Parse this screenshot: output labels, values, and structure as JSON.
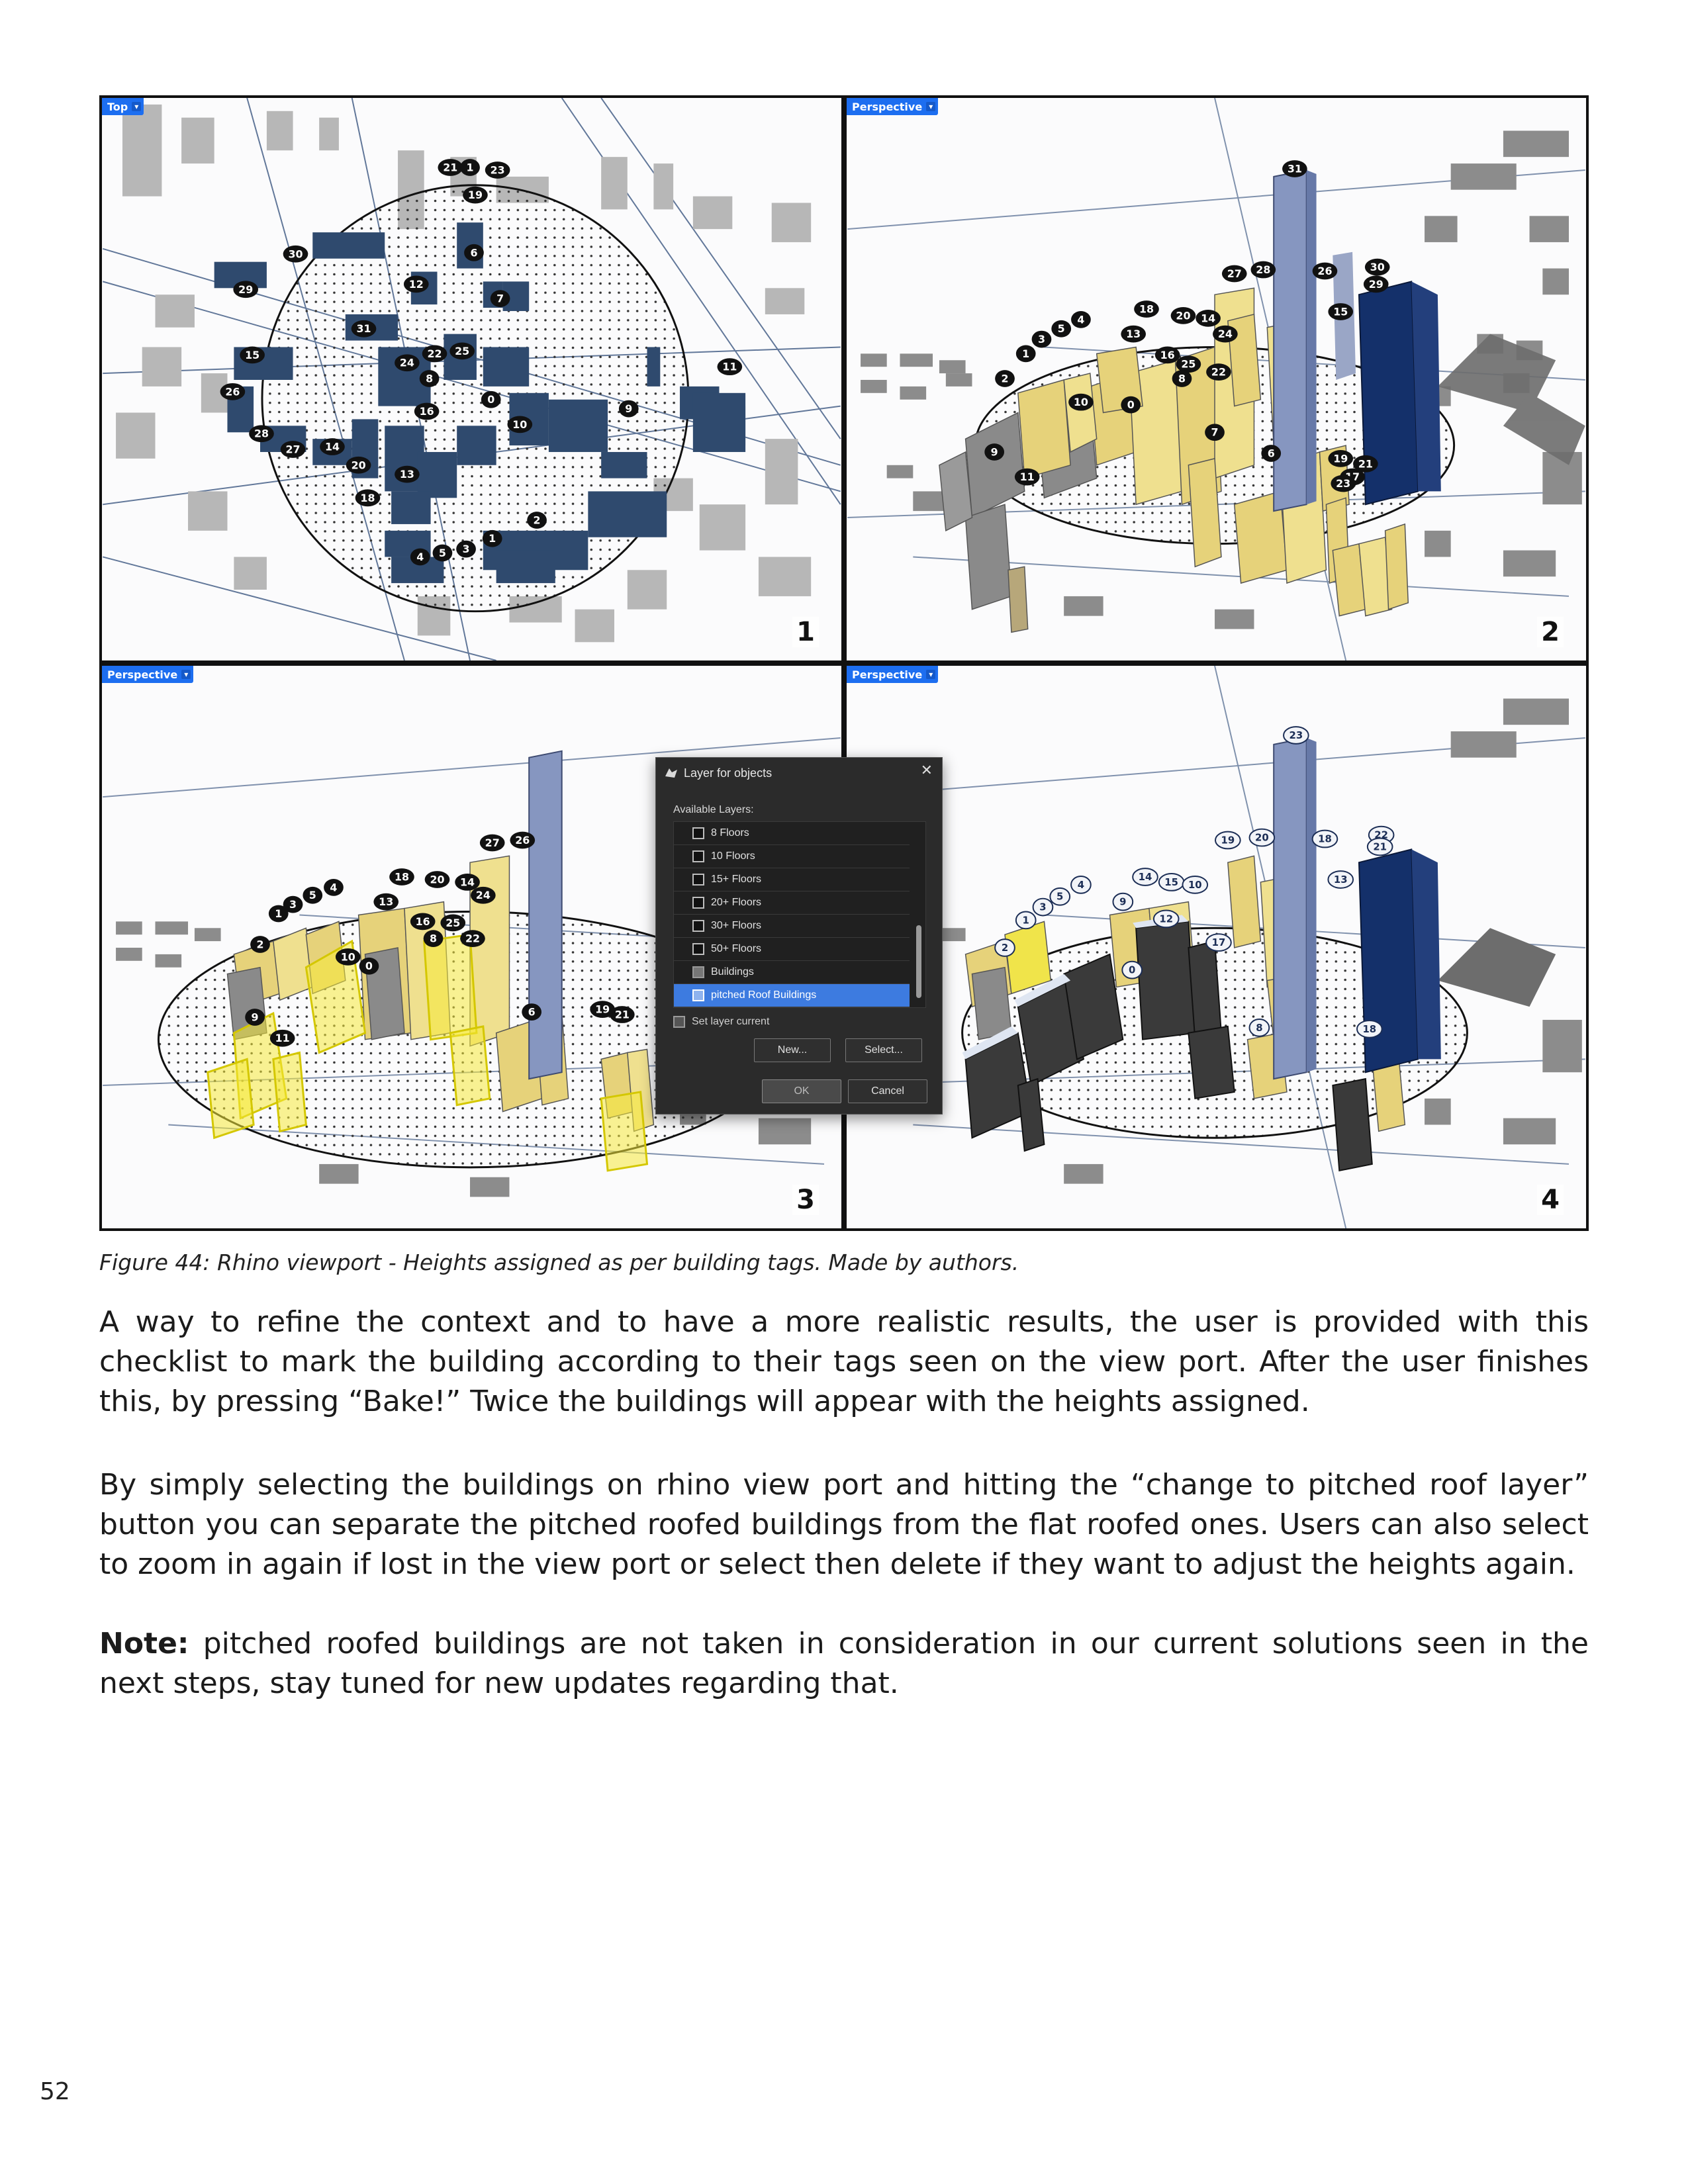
{
  "figure": {
    "viewports": [
      {
        "label": "Top",
        "number": "1"
      },
      {
        "label": "Perspective",
        "number": "2"
      },
      {
        "label": "Perspective",
        "number": "3"
      },
      {
        "label": "Perspective",
        "number": "4"
      }
    ],
    "vp1_tags": [
      "21",
      "1",
      "23",
      "19",
      "6",
      "30",
      "29",
      "12",
      "7",
      "31",
      "15",
      "24",
      "22",
      "25",
      "8",
      "26",
      "0",
      "16",
      "10",
      "11",
      "9",
      "28",
      "27",
      "14",
      "20",
      "13",
      "18",
      "2",
      "1",
      "3",
      "5",
      "4"
    ],
    "vp2_tags": [
      "31",
      "27",
      "28",
      "26",
      "30",
      "29",
      "15",
      "18",
      "20",
      "14",
      "13",
      "24",
      "4",
      "5",
      "3",
      "1",
      "16",
      "25",
      "2",
      "8",
      "22",
      "10",
      "0",
      "7",
      "6",
      "9",
      "11",
      "19",
      "21",
      "17",
      "23"
    ],
    "vp3_tags": [
      "27",
      "26",
      "18",
      "20",
      "14",
      "5",
      "4",
      "3",
      "1",
      "13",
      "16",
      "24",
      "25",
      "2",
      "8",
      "22",
      "10",
      "0",
      "9",
      "11",
      "6",
      "19",
      "21"
    ],
    "vp4_tags": [
      "23",
      "19",
      "20",
      "18",
      "22",
      "21",
      "13",
      "4",
      "5",
      "3",
      "1",
      "14",
      "15",
      "10",
      "9",
      "12",
      "17",
      "2",
      "0",
      "8",
      "18"
    ],
    "dialog": {
      "title": "Layer for objects",
      "available_label": "Available Layers:",
      "layers": [
        "8 Floors",
        "10 Floors",
        "15+ Floors",
        "20+ Floors",
        "30+ Floors",
        "50+ Floors",
        "Buildings",
        "pitched Roof Buildings"
      ],
      "selected_layer": "pitched Roof Buildings",
      "set_layer_current": "Set layer current",
      "new_button": "New...",
      "select_button": "Select...",
      "ok_button": "OK",
      "cancel_button": "Cancel"
    }
  },
  "caption": "Figure 44: Rhino viewport - Heights assigned as per building tags. Made by authors.",
  "paragraph1": "A way to refine the context and to have a more realistic results, the user is provided with this checklist to mark the building according to their tags seen on the view port. After the user finishes this, by pressing “Bake!” Twice the buildings will appear with the heights assigned.",
  "paragraph2": "By simply selecting the buildings on rhino view port and hitting the “change to pitched roof layer” button you can separate the pitched roofed buildings from the flat roofed ones. Users can also select to zoom in again if lost in the view port or select then delete if they want to adjust the heights again.",
  "note_label": "Note:",
  "note_text": " pitched roofed buildings are not taken in consideration in our current solutions seen in the next steps, stay tuned for new updates regarding that.",
  "page_number": "52",
  "colors": {
    "accent_blue": "#1d6ef0",
    "building_navy": "#2f4a6e",
    "building_yellow": "#e6d27a",
    "selected_yellow": "#f5ea3a",
    "building_gray": "#7f7f7f",
    "tower_blue": "#14306a"
  }
}
